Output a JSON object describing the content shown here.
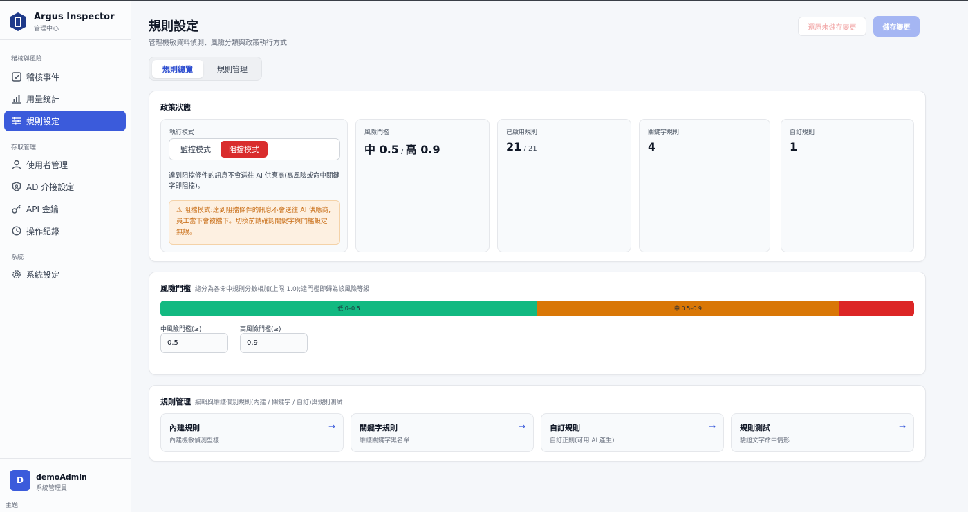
{
  "brand": {
    "title": "Argus Inspector",
    "subtitle": "管理中心"
  },
  "sidebar": {
    "sections": [
      {
        "label": "稽核與風險"
      },
      {
        "label": "存取管理"
      },
      {
        "label": "系統"
      }
    ],
    "items": [
      {
        "label": "稽核事件",
        "icon": "checkbox-icon",
        "active": false
      },
      {
        "label": "用量統計",
        "icon": "bar-chart-icon",
        "active": false
      },
      {
        "label": "規則設定",
        "icon": "sliders-icon",
        "active": true
      },
      {
        "label": "使用者管理",
        "icon": "user-icon",
        "active": false
      },
      {
        "label": "AD 介接設定",
        "icon": "shield-icon",
        "active": false
      },
      {
        "label": "API 金鑰",
        "icon": "key-icon",
        "active": false
      },
      {
        "label": "操作紀錄",
        "icon": "clock-icon",
        "active": false
      },
      {
        "label": "系統設定",
        "icon": "gear-icon",
        "active": false
      }
    ]
  },
  "user": {
    "initial": "D",
    "name": "demoAdmin",
    "role": "系統管理員"
  },
  "theme_label": "主題",
  "header": {
    "title": "規則設定",
    "subtitle": "管理機敏資料偵測、風險分類與政策執行方式",
    "revert_label": "還原未儲存變更",
    "save_label": "儲存變更"
  },
  "tabs": [
    {
      "label": "規則總覽",
      "active": true
    },
    {
      "label": "規則管理",
      "active": false
    }
  ],
  "policy": {
    "title": "政策狀態",
    "mode": {
      "label": "執行模式",
      "monitor_label": "監控模式",
      "block_label": "阻擋模式",
      "selected": "阻擋模式",
      "description": "達到阻擋條件的訊息不會送往 AI 供應商(高風險或命中關鍵字即阻擋)。",
      "warning": "⚠ 阻擋模式:達到阻擋條件的訊息不會送往 AI 供應商,員工當下會被擋下。切換前請確認關鍵字與門檻設定無誤。"
    },
    "stats": {
      "threshold": {
        "label": "風險門檻",
        "medium_prefix": "中 ",
        "medium": "0.5",
        "sep": " / ",
        "high_prefix": "高 ",
        "high": "0.9"
      },
      "enabled": {
        "label": "已啟用規則",
        "value": "21",
        "total": " / 21"
      },
      "keyword": {
        "label": "關鍵字規則",
        "value": "4"
      },
      "custom": {
        "label": "自訂規則",
        "value": "1"
      }
    }
  },
  "risk": {
    "title": "風險門檻",
    "desc": "總分為各命中規則分數相加(上限 1.0);達門檻即歸為該風險等級",
    "bands": [
      {
        "label": "低 0–0.5",
        "from": 0,
        "to": 0.5,
        "color": "#12b981"
      },
      {
        "label": "中 0.5–0.9",
        "from": 0.5,
        "to": 0.9,
        "color": "#d97706"
      },
      {
        "label": "",
        "from": 0.9,
        "to": 1.0,
        "color": "#dc2626"
      }
    ],
    "medium_label": "中風險門檻(≥)",
    "medium_value": "0.5",
    "high_label": "高風險門檻(≥)",
    "high_value": "0.9"
  },
  "rules": {
    "title": "規則管理",
    "desc": "編輯與維護個別規則(內建 / 關鍵字 / 自訂)與規則測試",
    "cards": [
      {
        "title": "內建規則",
        "sub": "內建機敏偵測型樣",
        "arrow": "→"
      },
      {
        "title": "關鍵字規則",
        "sub": "維護關鍵字黑名單",
        "arrow": "→"
      },
      {
        "title": "自訂規則",
        "sub": "自訂正則(可用 AI 產生)",
        "arrow": "→"
      },
      {
        "title": "規則測試",
        "sub": "驗證文字命中情形",
        "arrow": "→"
      }
    ]
  },
  "colors": {
    "accent": "#3b5bdb",
    "danger": "#d92d2d",
    "warning_bg": "#fdf0e1",
    "warning_text": "#c86b12"
  }
}
